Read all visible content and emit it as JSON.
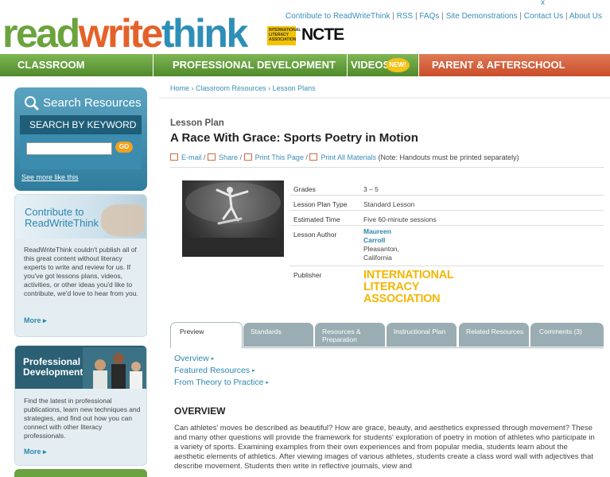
{
  "top": {
    "close": "x",
    "links": [
      "Contribute to ReadWriteThink",
      "RSS",
      "FAQs",
      "Site Demonstrations",
      "Contact Us",
      "About Us"
    ]
  },
  "logo": {
    "part1": "read",
    "part2": "write",
    "part3": "think",
    "ila_small": "INTERNATIONAL LITERACY ASSOCIATION",
    "ncte": "NCTE"
  },
  "nav": {
    "classroom": "CLASSROOM RESOURCES",
    "professional": "PROFESSIONAL DEVELOPMENT",
    "videos": "VIDEOS",
    "new_badge": "NEW!",
    "parent": "PARENT & AFTERSCHOOL RESOURCES"
  },
  "sidebar": {
    "search_title": "Search Resources",
    "keyword_label": "SEARCH BY KEYWORD",
    "search_placeholder": "",
    "go": "GO",
    "see_more": "See more like this",
    "contrib_title_1": "Contribute to",
    "contrib_title_2": "ReadWriteThink",
    "contrib_text": "ReadWriteThink couldn't publish all of this great content without literacy experts to write and review for us. If you've got lessons plans, videos, activities, or other ideas you'd like to contribute, we'd love to hear from you.",
    "contrib_more": "More",
    "prof_title_1": "Professional",
    "prof_title_2": "Development",
    "prof_text": "Find the latest in professional publications, learn new techniques and strategies, and find out how you can connect with other literacy professionals.",
    "prof_more": "More"
  },
  "breadcrumb": [
    "Home",
    "Classroom Resources",
    "Lesson Plans"
  ],
  "lesson": {
    "label": "Lesson Plan",
    "title": "A Race With Grace: Sports Poetry in Motion"
  },
  "tools": {
    "email": "E-mail",
    "share": "Share",
    "print_page": "Print This Page",
    "print_all": "Print All Materials",
    "note": "(Note: Handouts must be printed separately)"
  },
  "info": {
    "grades_label": "Grades",
    "grades_value": "3 – 5",
    "type_label": "Lesson Plan Type",
    "type_value": "Standard Lesson",
    "time_label": "Estimated Time",
    "time_value": "Five 60-minute sessions",
    "author_label": "Lesson Author",
    "author_first": "Maureen",
    "author_last": "Carroll",
    "author_city": "Pleasanton,",
    "author_state": "California",
    "publisher_label": "Publisher",
    "publisher_line1": "INTERNATIONAL",
    "publisher_line2": "LITERACY",
    "publisher_line3": "ASSOCIATION"
  },
  "tabs": {
    "preview": "Preview",
    "standards": "Standards",
    "resources": "Resources & Preparation",
    "instructional": "Instructional Plan",
    "related": "Related Resources",
    "comments": "Comments (3)"
  },
  "anchors": [
    "Overview",
    "Featured Resources",
    "From Theory to Practice"
  ],
  "overview": {
    "heading": "OVERVIEW",
    "text": "Can athletes' moves be described as beautiful? How are grace, beauty, and aesthetics expressed through movement? These and many other questions will provide the framework for students' exploration of poetry in motion of athletes who participate in a variety of sports. Examining examples from their own experiences and from popular media, students learn about the aesthetic elements of athletics. After viewing images of various athletes, students create a class word wall with adjectives that describe movement. Students then write in reflective journals, view and"
  }
}
